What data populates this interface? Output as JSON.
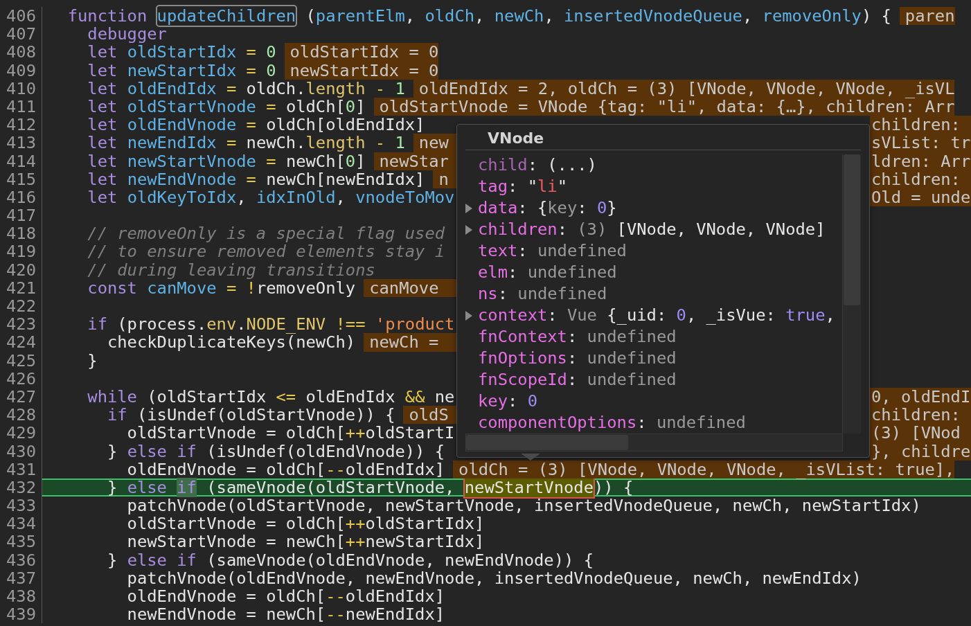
{
  "editor": {
    "lines": [
      {
        "number": "406",
        "current": false,
        "kind": "full",
        "code": [
          {
            "text": "  function ",
            "kind": "kw"
          },
          {
            "text": "updateChildren",
            "kind": "boxed"
          },
          {
            "text": " (",
            "kind": "plain"
          },
          {
            "text": "parentElm",
            "kind": "ident"
          },
          {
            "text": ", ",
            "kind": "plain"
          },
          {
            "text": "oldCh",
            "kind": "ident"
          },
          {
            "text": ", ",
            "kind": "plain"
          },
          {
            "text": "newCh",
            "kind": "ident"
          },
          {
            "text": ", ",
            "kind": "plain"
          },
          {
            "text": "insertedVnodeQueue",
            "kind": "ident"
          },
          {
            "text": ", ",
            "kind": "plain"
          },
          {
            "text": "removeOnly",
            "kind": "ident"
          },
          {
            "text": ") {",
            "kind": "plain"
          }
        ],
        "value": "paren"
      },
      {
        "number": "407",
        "current": false,
        "kind": "full",
        "code": [
          {
            "text": "    debugger",
            "kind": "kw"
          }
        ]
      },
      {
        "number": "408",
        "current": false,
        "kind": "full",
        "code": [
          {
            "text": "    let ",
            "kind": "kw"
          },
          {
            "text": "oldStartIdx",
            "kind": "ident"
          },
          {
            "text": " = ",
            "kind": "op"
          },
          {
            "text": "0",
            "kind": "num"
          }
        ],
        "value": "oldStartIdx = 0"
      },
      {
        "number": "409",
        "current": false,
        "kind": "full",
        "code": [
          {
            "text": "    let ",
            "kind": "kw"
          },
          {
            "text": "newStartIdx",
            "kind": "ident"
          },
          {
            "text": " = ",
            "kind": "op"
          },
          {
            "text": "0",
            "kind": "num"
          }
        ],
        "value": "newStartIdx = 0"
      },
      {
        "number": "410",
        "current": false,
        "kind": "full",
        "code": [
          {
            "text": "    let ",
            "kind": "kw"
          },
          {
            "text": "oldEndIdx",
            "kind": "ident"
          },
          {
            "text": " = ",
            "kind": "op"
          },
          {
            "text": "oldCh.",
            "kind": "plain"
          },
          {
            "text": "length",
            "kind": "prop"
          },
          {
            "text": " - ",
            "kind": "op"
          },
          {
            "text": "1",
            "kind": "num"
          }
        ],
        "value": "oldEndIdx = 2, oldCh = (3) [VNode, VNode, VNode, _isVL"
      },
      {
        "number": "411",
        "current": false,
        "kind": "full",
        "code": [
          {
            "text": "    let ",
            "kind": "kw"
          },
          {
            "text": "oldStartVnode",
            "kind": "ident"
          },
          {
            "text": " = ",
            "kind": "op"
          },
          {
            "text": "oldCh[",
            "kind": "plain"
          },
          {
            "text": "0",
            "kind": "num"
          },
          {
            "text": "]",
            "kind": "plain"
          }
        ],
        "value": "oldStartVnode = VNode {tag: \"li\", data: {…}, children: Arr"
      },
      {
        "number": "412",
        "current": false,
        "kind": "split",
        "code": [
          {
            "text": "    let ",
            "kind": "kw"
          },
          {
            "text": "oldEndVnode",
            "kind": "ident"
          },
          {
            "text": " = ",
            "kind": "op"
          },
          {
            "text": "oldCh[oldEndIdx]",
            "kind": "plain"
          }
        ],
        "value_right": "children:"
      },
      {
        "number": "413",
        "current": false,
        "kind": "split",
        "code": [
          {
            "text": "    let ",
            "kind": "kw"
          },
          {
            "text": "newEndIdx",
            "kind": "ident"
          },
          {
            "text": " = ",
            "kind": "op"
          },
          {
            "text": "newCh.",
            "kind": "plain"
          },
          {
            "text": "length",
            "kind": "prop"
          },
          {
            "text": " - ",
            "kind": "op"
          },
          {
            "text": "1",
            "kind": "num"
          }
        ],
        "value": "new",
        "value_right": "sVList: tr"
      },
      {
        "number": "414",
        "current": false,
        "kind": "split",
        "code": [
          {
            "text": "    let ",
            "kind": "kw"
          },
          {
            "text": "newStartVnode",
            "kind": "ident"
          },
          {
            "text": " = ",
            "kind": "op"
          },
          {
            "text": "newCh[",
            "kind": "plain"
          },
          {
            "text": "0",
            "kind": "num"
          },
          {
            "text": "]",
            "kind": "plain"
          }
        ],
        "value": "newStar",
        "value_right": "ldren: Arr"
      },
      {
        "number": "415",
        "current": false,
        "kind": "split",
        "code": [
          {
            "text": "    let ",
            "kind": "kw"
          },
          {
            "text": "newEndVnode",
            "kind": "ident"
          },
          {
            "text": " = ",
            "kind": "op"
          },
          {
            "text": "newCh[newEndIdx]",
            "kind": "plain"
          }
        ],
        "value": "n",
        "value_right": "children:"
      },
      {
        "number": "416",
        "current": false,
        "kind": "split",
        "code": [
          {
            "text": "    let ",
            "kind": "kw"
          },
          {
            "text": "oldKeyToIdx",
            "kind": "ident"
          },
          {
            "text": ", ",
            "kind": "plain"
          },
          {
            "text": "idxInOld",
            "kind": "ident"
          },
          {
            "text": ", ",
            "kind": "plain"
          },
          {
            "text": "vnodeToMov",
            "kind": "ident"
          }
        ],
        "value_right": "Old = unde"
      },
      {
        "number": "417",
        "current": false,
        "kind": "split"
      },
      {
        "number": "418",
        "current": false,
        "kind": "split",
        "code": [
          {
            "text": "    // removeOnly is a special flag used",
            "kind": "comment"
          }
        ]
      },
      {
        "number": "419",
        "current": false,
        "kind": "split",
        "code": [
          {
            "text": "    // to ensure removed elements stay i",
            "kind": "comment"
          }
        ]
      },
      {
        "number": "420",
        "current": false,
        "kind": "split",
        "code": [
          {
            "text": "    // during leaving transitions",
            "kind": "comment"
          }
        ]
      },
      {
        "number": "421",
        "current": false,
        "kind": "split",
        "code": [
          {
            "text": "    const ",
            "kind": "kw"
          },
          {
            "text": "canMove",
            "kind": "ident"
          },
          {
            "text": " = !",
            "kind": "op"
          },
          {
            "text": "removeOnly",
            "kind": "plain"
          }
        ],
        "value": "canMove"
      },
      {
        "number": "422",
        "current": false,
        "kind": "split"
      },
      {
        "number": "423",
        "current": false,
        "kind": "split",
        "code": [
          {
            "text": "    if ",
            "kind": "kw"
          },
          {
            "text": "(process.",
            "kind": "plain"
          },
          {
            "text": "env",
            "kind": "prop"
          },
          {
            "text": ".",
            "kind": "plain"
          },
          {
            "text": "NODE_ENV",
            "kind": "prop"
          },
          {
            "text": " !== ",
            "kind": "op"
          },
          {
            "text": "'product",
            "kind": "str"
          }
        ]
      },
      {
        "number": "424",
        "current": false,
        "kind": "split",
        "code": [
          {
            "text": "      checkDuplicateKeys(newCh)",
            "kind": "plain"
          }
        ],
        "value": "newCh ="
      },
      {
        "number": "425",
        "current": false,
        "kind": "split",
        "code": [
          {
            "text": "    }",
            "kind": "plain"
          }
        ]
      },
      {
        "number": "426",
        "current": false,
        "kind": "split"
      },
      {
        "number": "427",
        "current": false,
        "kind": "split",
        "code": [
          {
            "text": "    while ",
            "kind": "kw"
          },
          {
            "text": "(oldStartIdx ",
            "kind": "plain"
          },
          {
            "text": "<=",
            "kind": "op"
          },
          {
            "text": " oldEndIdx ",
            "kind": "plain"
          },
          {
            "text": "&&",
            "kind": "op"
          },
          {
            "text": " ne",
            "kind": "plain"
          }
        ],
        "value_right": "0, oldEndI"
      },
      {
        "number": "428",
        "current": false,
        "kind": "split",
        "code": [
          {
            "text": "      if ",
            "kind": "kw"
          },
          {
            "text": "(isUndef(oldStartVnode)) {",
            "kind": "plain"
          }
        ],
        "value": "oldS",
        "value_right": "children:"
      },
      {
        "number": "429",
        "current": false,
        "kind": "split",
        "code": [
          {
            "text": "        oldStartVnode = oldCh[",
            "kind": "plain"
          },
          {
            "text": "++",
            "kind": "op"
          },
          {
            "text": "oldStartI",
            "kind": "plain"
          }
        ],
        "value_right": "(3) [VNod"
      },
      {
        "number": "430",
        "current": false,
        "kind": "split",
        "code": [
          {
            "text": "      } ",
            "kind": "plain"
          },
          {
            "text": "else if ",
            "kind": "kw"
          },
          {
            "text": "(isUndef(oldEndVnode)) {",
            "kind": "plain"
          }
        ],
        "value_right": "}, childre"
      },
      {
        "number": "431",
        "current": false,
        "kind": "full",
        "code": [
          {
            "text": "        oldEndVnode = oldCh[",
            "kind": "plain"
          },
          {
            "text": "--",
            "kind": "op"
          },
          {
            "text": "oldEndIdx]",
            "kind": "plain"
          }
        ],
        "value": "oldCh = (3) [VNode, VNode, VNode, _isVList: true],"
      },
      {
        "number": "432",
        "current": true,
        "kind": "full",
        "code": [
          {
            "text": "      } ",
            "kind": "plain"
          },
          {
            "text": "else ",
            "kind": "kw"
          },
          {
            "text": "if",
            "kind": "ifmark"
          },
          {
            "text": " (sameVnode(oldStartVnode, ",
            "kind": "plain"
          },
          {
            "text": "newStartVnode",
            "kind": "match"
          },
          {
            "text": ")) {",
            "kind": "plain"
          }
        ]
      },
      {
        "number": "433",
        "current": false,
        "kind": "full",
        "code": [
          {
            "text": "        patchVnode(oldStartVnode, newStartVnode, insertedVnodeQueue, newCh, newStartIdx)",
            "kind": "plain"
          }
        ]
      },
      {
        "number": "434",
        "current": false,
        "kind": "full",
        "code": [
          {
            "text": "        oldStartVnode = oldCh[",
            "kind": "plain"
          },
          {
            "text": "++",
            "kind": "op"
          },
          {
            "text": "oldStartIdx]",
            "kind": "plain"
          }
        ]
      },
      {
        "number": "435",
        "current": false,
        "kind": "full",
        "code": [
          {
            "text": "        newStartVnode = newCh[",
            "kind": "plain"
          },
          {
            "text": "++",
            "kind": "op"
          },
          {
            "text": "newStartIdx]",
            "kind": "plain"
          }
        ]
      },
      {
        "number": "436",
        "current": false,
        "kind": "full",
        "code": [
          {
            "text": "      } ",
            "kind": "plain"
          },
          {
            "text": "else if ",
            "kind": "kw"
          },
          {
            "text": "(sameVnode(oldEndVnode, newEndVnode)) {",
            "kind": "plain"
          }
        ]
      },
      {
        "number": "437",
        "current": false,
        "kind": "full",
        "code": [
          {
            "text": "        patchVnode(oldEndVnode, newEndVnode, insertedVnodeQueue, newCh, newEndIdx)",
            "kind": "plain"
          }
        ]
      },
      {
        "number": "438",
        "current": false,
        "kind": "full",
        "code": [
          {
            "text": "        oldEndVnode = oldCh[",
            "kind": "plain"
          },
          {
            "text": "--",
            "kind": "op"
          },
          {
            "text": "oldEndIdx]",
            "kind": "plain"
          }
        ]
      },
      {
        "number": "439",
        "current": false,
        "kind": "full",
        "code": [
          {
            "text": "        newEndVnode = newCh[",
            "kind": "plain"
          },
          {
            "text": "--",
            "kind": "op"
          },
          {
            "text": "newEndIdx]",
            "kind": "plain"
          }
        ]
      }
    ]
  },
  "popover": {
    "title": "VNode",
    "properties": [
      {
        "key": "child",
        "kind": "getter",
        "expandable": false,
        "value": [
          {
            "text": ": (...)",
            "kind": "plain"
          }
        ]
      },
      {
        "key": "tag",
        "kind": "field",
        "expandable": false,
        "value": [
          {
            "text": ": \"",
            "kind": "plain"
          },
          {
            "text": "li",
            "kind": "str"
          },
          {
            "text": "\"",
            "kind": "plain"
          }
        ]
      },
      {
        "key": "data",
        "kind": "field",
        "expandable": true,
        "value": [
          {
            "text": ": {",
            "kind": "plain"
          },
          {
            "text": "key",
            "kind": "dim"
          },
          {
            "text": ": ",
            "kind": "plain"
          },
          {
            "text": "0",
            "kind": "num"
          },
          {
            "text": "}",
            "kind": "plain"
          }
        ]
      },
      {
        "key": "children",
        "kind": "field",
        "expandable": true,
        "value": [
          {
            "text": ": ",
            "kind": "plain"
          },
          {
            "text": "(3)",
            "kind": "dim"
          },
          {
            "text": " [VNode, VNode, VNode]",
            "kind": "plain"
          }
        ]
      },
      {
        "key": "text",
        "kind": "field",
        "expandable": false,
        "value": [
          {
            "text": ": ",
            "kind": "plain"
          },
          {
            "text": "undefined",
            "kind": "dim"
          }
        ]
      },
      {
        "key": "elm",
        "kind": "field",
        "expandable": false,
        "value": [
          {
            "text": ": ",
            "kind": "plain"
          },
          {
            "text": "undefined",
            "kind": "dim"
          }
        ]
      },
      {
        "key": "ns",
        "kind": "field",
        "expandable": false,
        "value": [
          {
            "text": ": ",
            "kind": "plain"
          },
          {
            "text": "undefined",
            "kind": "dim"
          }
        ]
      },
      {
        "key": "context",
        "kind": "field",
        "expandable": true,
        "value": [
          {
            "text": ": ",
            "kind": "plain"
          },
          {
            "text": "Vue",
            "kind": "dim"
          },
          {
            "text": " {_uid: ",
            "kind": "plain"
          },
          {
            "text": "0",
            "kind": "num"
          },
          {
            "text": ", _isVue: ",
            "kind": "plain"
          },
          {
            "text": "true",
            "kind": "num"
          },
          {
            "text": ",",
            "kind": "plain"
          }
        ]
      },
      {
        "key": "fnContext",
        "kind": "field",
        "expandable": false,
        "value": [
          {
            "text": ": ",
            "kind": "plain"
          },
          {
            "text": "undefined",
            "kind": "dim"
          }
        ]
      },
      {
        "key": "fnOptions",
        "kind": "field",
        "expandable": false,
        "value": [
          {
            "text": ": ",
            "kind": "plain"
          },
          {
            "text": "undefined",
            "kind": "dim"
          }
        ]
      },
      {
        "key": "fnScopeId",
        "kind": "field",
        "expandable": false,
        "value": [
          {
            "text": ": ",
            "kind": "plain"
          },
          {
            "text": "undefined",
            "kind": "dim"
          }
        ]
      },
      {
        "key": "key",
        "kind": "field",
        "expandable": false,
        "value": [
          {
            "text": ": ",
            "kind": "plain"
          },
          {
            "text": "0",
            "kind": "num"
          }
        ]
      },
      {
        "key": "componentOptions",
        "kind": "field",
        "expandable": false,
        "value": [
          {
            "text": ": ",
            "kind": "plain"
          },
          {
            "text": "undefined",
            "kind": "dim"
          }
        ]
      }
    ]
  }
}
